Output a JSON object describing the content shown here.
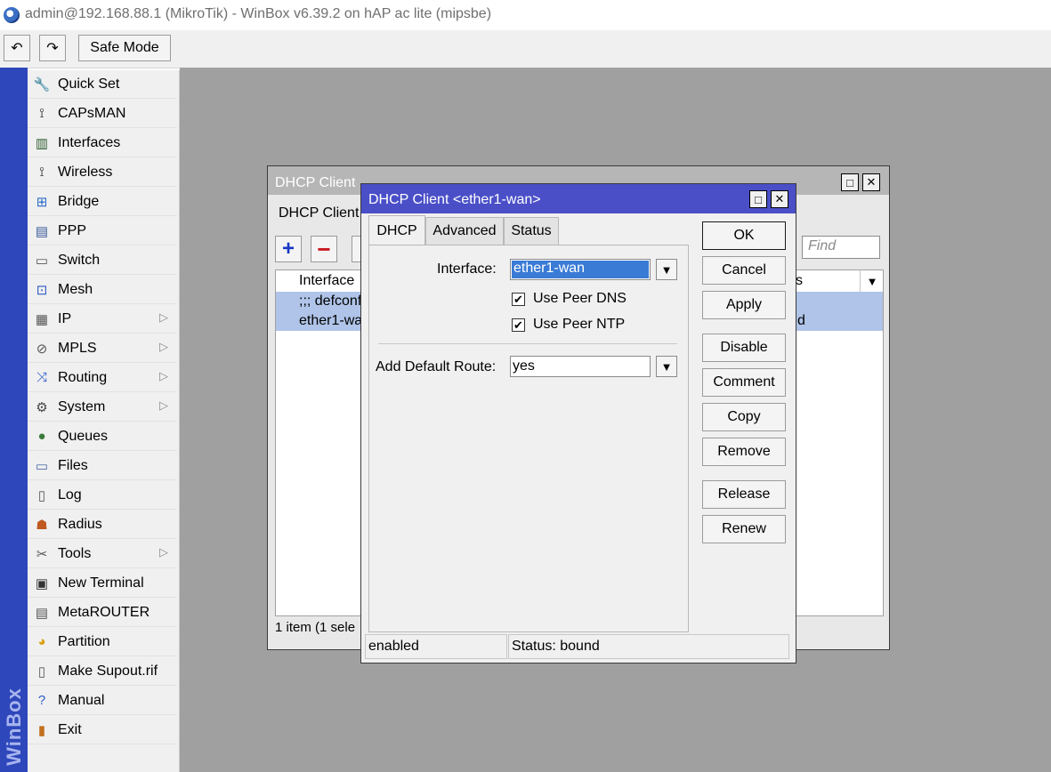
{
  "window": {
    "title": "admin@192.168.88.1 (MikroTik) - WinBox v6.39.2 on hAP ac lite (mipsbe)"
  },
  "toolbar": {
    "undo_icon": "↶",
    "redo_icon": "↷",
    "safe_mode_label": "Safe Mode"
  },
  "strip": {
    "label": "WinBox"
  },
  "sidebar": {
    "items": [
      {
        "label": "Quick Set",
        "icon": "quick-set-icon",
        "glyph": "🔧",
        "arrow": ""
      },
      {
        "label": "CAPsMAN",
        "icon": "capsman-icon",
        "glyph": "⟟",
        "arrow": ""
      },
      {
        "label": "Interfaces",
        "icon": "interfaces-icon",
        "glyph": "▥",
        "arrow": ""
      },
      {
        "label": "Wireless",
        "icon": "wireless-icon",
        "glyph": "⟟",
        "arrow": ""
      },
      {
        "label": "Bridge",
        "icon": "bridge-icon",
        "glyph": "⊞",
        "arrow": ""
      },
      {
        "label": "PPP",
        "icon": "ppp-icon",
        "glyph": "▤",
        "arrow": ""
      },
      {
        "label": "Switch",
        "icon": "switch-icon",
        "glyph": "▭",
        "arrow": ""
      },
      {
        "label": "Mesh",
        "icon": "mesh-icon",
        "glyph": "⊡",
        "arrow": ""
      },
      {
        "label": "IP",
        "icon": "ip-icon",
        "glyph": "▦",
        "arrow": "▷"
      },
      {
        "label": "MPLS",
        "icon": "mpls-icon",
        "glyph": "⊘",
        "arrow": "▷"
      },
      {
        "label": "Routing",
        "icon": "routing-icon",
        "glyph": "⤨",
        "arrow": "▷"
      },
      {
        "label": "System",
        "icon": "system-icon",
        "glyph": "⚙",
        "arrow": "▷"
      },
      {
        "label": "Queues",
        "icon": "queues-icon",
        "glyph": "●",
        "arrow": ""
      },
      {
        "label": "Files",
        "icon": "files-icon",
        "glyph": "▭",
        "arrow": ""
      },
      {
        "label": "Log",
        "icon": "log-icon",
        "glyph": "▯",
        "arrow": ""
      },
      {
        "label": "Radius",
        "icon": "radius-icon",
        "glyph": "☗",
        "arrow": ""
      },
      {
        "label": "Tools",
        "icon": "tools-icon",
        "glyph": "✂",
        "arrow": "▷"
      },
      {
        "label": "New Terminal",
        "icon": "terminal-icon",
        "glyph": "▣",
        "arrow": ""
      },
      {
        "label": "MetaROUTER",
        "icon": "metarouter-icon",
        "glyph": "▤",
        "arrow": ""
      },
      {
        "label": "Partition",
        "icon": "partition-icon",
        "glyph": "◕",
        "arrow": ""
      },
      {
        "label": "Make Supout.rif",
        "icon": "supout-icon",
        "glyph": "▯",
        "arrow": ""
      },
      {
        "label": "Manual",
        "icon": "manual-icon",
        "glyph": "?",
        "arrow": ""
      },
      {
        "label": "Exit",
        "icon": "exit-icon",
        "glyph": "▮",
        "arrow": ""
      }
    ]
  },
  "bg_window": {
    "title": "DHCP Client",
    "tab_label": "DHCP Client",
    "add_glyph": "+",
    "remove_glyph": "−",
    "find_placeholder": "Find",
    "col_interface": "Interface",
    "col_status_partial": "s",
    "rows": [
      {
        "interface": ";;; defconf",
        "status": ""
      },
      {
        "interface": "ether1-wa",
        "status": "d"
      }
    ],
    "footer": "1 item (1 sele",
    "max_glyph": "□",
    "close_glyph": "✕"
  },
  "dialog": {
    "title": "DHCP Client <ether1-wan>",
    "max_glyph": "□",
    "close_glyph": "✕",
    "tabs": [
      "DHCP",
      "Advanced",
      "Status"
    ],
    "interface_label": "Interface:",
    "interface_value": "ether1-wan",
    "use_peer_dns_label": "Use Peer DNS",
    "use_peer_ntp_label": "Use Peer NTP",
    "check_glyph": "✔",
    "add_default_route_label": "Add Default Route:",
    "add_default_route_value": "yes",
    "dropdown_glyph": "▼",
    "buttons": {
      "ok": "OK",
      "cancel": "Cancel",
      "apply": "Apply",
      "disable": "Disable",
      "comment": "Comment",
      "copy": "Copy",
      "remove": "Remove",
      "release": "Release",
      "renew": "Renew"
    },
    "status_left": "enabled",
    "status_right": "Status: bound"
  },
  "colors": {
    "strip": "#2e47bb",
    "dialog_title": "#4a4fc8",
    "selection": "#afc4e8",
    "workspace": "#a0a0a0"
  }
}
